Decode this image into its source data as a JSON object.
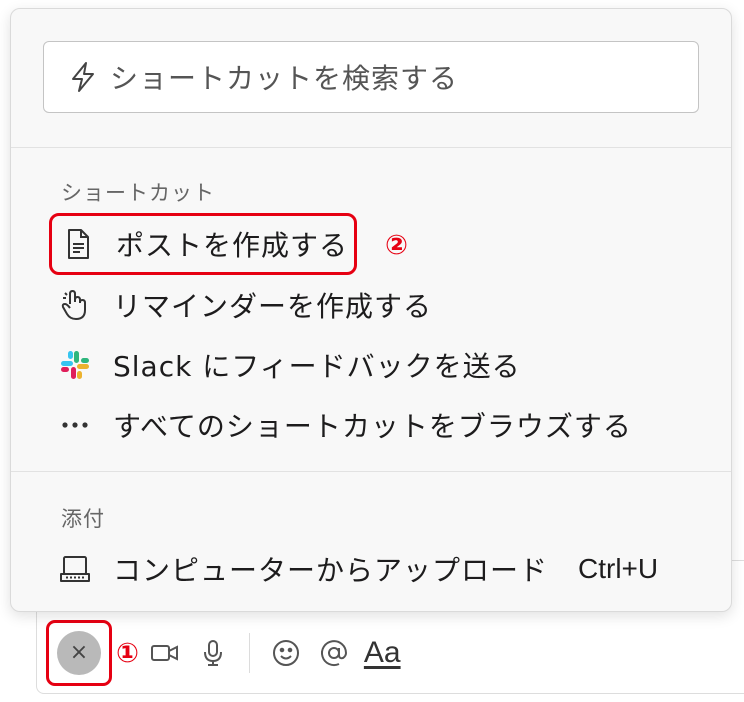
{
  "search": {
    "placeholder": "ショートカットを検索する",
    "icon": "lightning-icon"
  },
  "shortcuts": {
    "title": "ショートカット",
    "items": [
      {
        "label": "ポストを作成する",
        "icon": "document-icon",
        "highlighted": true
      },
      {
        "label": "リマインダーを作成する",
        "icon": "hand-icon"
      },
      {
        "label": "Slack にフィードバックを送る",
        "icon": "slack-logo-icon"
      },
      {
        "label": "すべてのショートカットをブラウズする",
        "icon": "ellipsis-icon"
      }
    ]
  },
  "attach": {
    "title": "添付",
    "items": [
      {
        "label": "コンピューターからアップロード",
        "shortcut": "Ctrl+U",
        "icon": "laptop-icon"
      }
    ]
  },
  "annotations": {
    "step1": "①",
    "step2": "②",
    "highlight_color": "#e60012"
  },
  "toolbar": {
    "close_symbol": "×",
    "format_label": "Aa"
  }
}
